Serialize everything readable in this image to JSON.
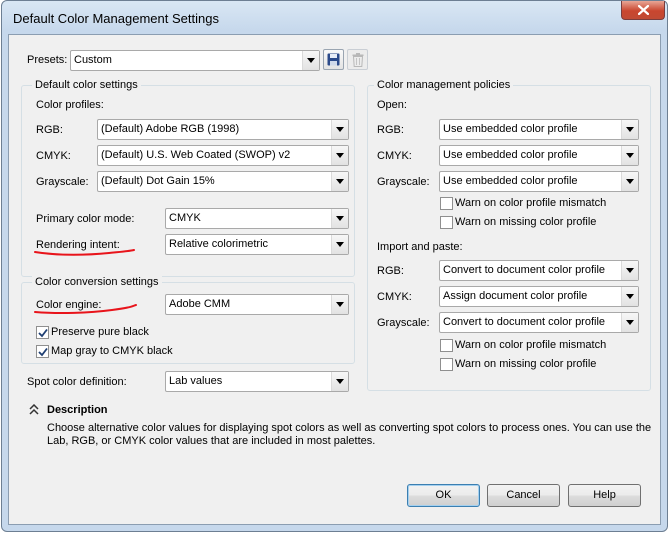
{
  "window": {
    "title": "Default Color Management Settings"
  },
  "presets": {
    "label": "Presets:",
    "value": "Custom"
  },
  "default_color_settings": {
    "title": "Default color settings",
    "color_profiles_label": "Color profiles:",
    "rows": [
      {
        "label": "RGB:",
        "value": "(Default) Adobe RGB (1998)"
      },
      {
        "label": "CMYK:",
        "value": "(Default) U.S. Web Coated (SWOP) v2"
      },
      {
        "label": "Grayscale:",
        "value": "(Default) Dot Gain 15%"
      }
    ],
    "primary_color_mode": {
      "label": "Primary color mode:",
      "value": "CMYK"
    },
    "rendering_intent": {
      "label": "Rendering intent:",
      "value": "Relative colorimetric"
    }
  },
  "color_conversion_settings": {
    "title": "Color conversion settings",
    "color_engine": {
      "label": "Color engine:",
      "value": "Adobe CMM"
    },
    "preserve_pure_black": {
      "label": "Preserve pure black",
      "checked": true
    },
    "map_gray": {
      "label": "Map gray to CMYK black",
      "checked": true
    }
  },
  "spot_color": {
    "label": "Spot color definition:",
    "value": "Lab values"
  },
  "policies": {
    "title": "Color management policies",
    "open": {
      "label": "Open:",
      "rows": [
        {
          "label": "RGB:",
          "value": "Use embedded color profile"
        },
        {
          "label": "CMYK:",
          "value": "Use embedded color profile"
        },
        {
          "label": "Grayscale:",
          "value": "Use embedded color profile"
        }
      ],
      "warn_mismatch": {
        "label": "Warn on color profile mismatch",
        "checked": false
      },
      "warn_missing": {
        "label": "Warn on missing color profile",
        "checked": false
      }
    },
    "import": {
      "label": "Import and paste:",
      "rows": [
        {
          "label": "RGB:",
          "value": "Convert to document color profile"
        },
        {
          "label": "CMYK:",
          "value": "Assign document color profile"
        },
        {
          "label": "Grayscale:",
          "value": "Convert to document color profile"
        }
      ],
      "warn_mismatch": {
        "label": "Warn on color profile mismatch",
        "checked": false
      },
      "warn_missing": {
        "label": "Warn on missing color profile",
        "checked": false
      }
    }
  },
  "description": {
    "title": "Description",
    "line1": "Choose alternative color values for displaying spot colors as well as converting spot colors to process ones. You can use the",
    "line2": "Lab, RGB, or CMYK color values that are included in most palettes."
  },
  "buttons": {
    "ok": "OK",
    "cancel": "Cancel",
    "help": "Help"
  },
  "colors": {
    "annotation_red": "#e8141b",
    "accent_blue": "#3c7fb1"
  }
}
